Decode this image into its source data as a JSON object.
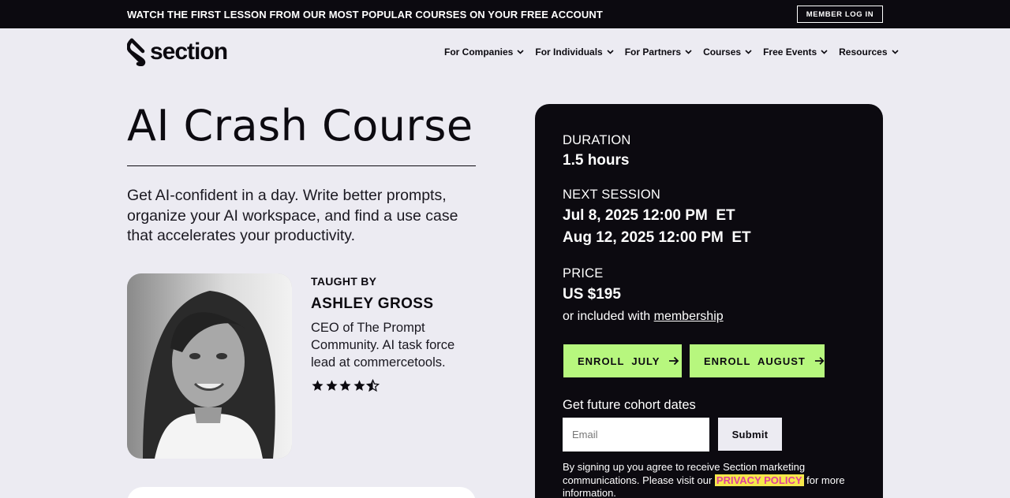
{
  "announcement": {
    "text": "WATCH THE FIRST LESSON FROM OUR MOST POPULAR COURSES ON YOUR FREE ACCOUNT",
    "member_login": "MEMBER LOG IN"
  },
  "header": {
    "logo_text": "section",
    "nav": [
      {
        "label": "For Companies"
      },
      {
        "label": "For Individuals"
      },
      {
        "label": "For Partners"
      },
      {
        "label": "Courses"
      },
      {
        "label": "Free Events"
      },
      {
        "label": "Resources"
      }
    ]
  },
  "course": {
    "title": "AI Crash Course",
    "subtitle": "Get AI-confident in a day. Write better prompts, organize your AI workspace, and find a use case that accelerates your productivity.",
    "instructor": {
      "heading": "TAUGHT BY",
      "name": "ASHLEY GROSS",
      "bio": "CEO of The Prompt Community. AI task force lead at commercetools.",
      "rating": 4.5
    }
  },
  "panel": {
    "duration_label": "DURATION",
    "duration_value": "1.5 hours",
    "session_label": "NEXT SESSION",
    "sessions": [
      "Jul 8, 2025 12:00 PM  ET",
      "Aug 12, 2025 12:00 PM  ET"
    ],
    "price_label": "PRICE",
    "price_value": "US $195",
    "membership_prefix": "or included with ",
    "membership_link": "membership",
    "enroll_july": "ENROLL  JULY",
    "enroll_august": "ENROLL  AUGUST",
    "future_label": "Get future cohort dates",
    "email_placeholder": "Email",
    "submit": "Submit",
    "legal_prefix": "By signing up you agree to receive Section marketing communications. Please visit our ",
    "legal_link": "PRIVACY POLICY",
    "legal_suffix": " for more information."
  },
  "colors": {
    "dark": "#0c0a10",
    "background": "#ecebf2",
    "accent_green": "#b7f77e",
    "highlight_yellow": "#f6e84b",
    "highlight_pink": "#e0409a"
  }
}
